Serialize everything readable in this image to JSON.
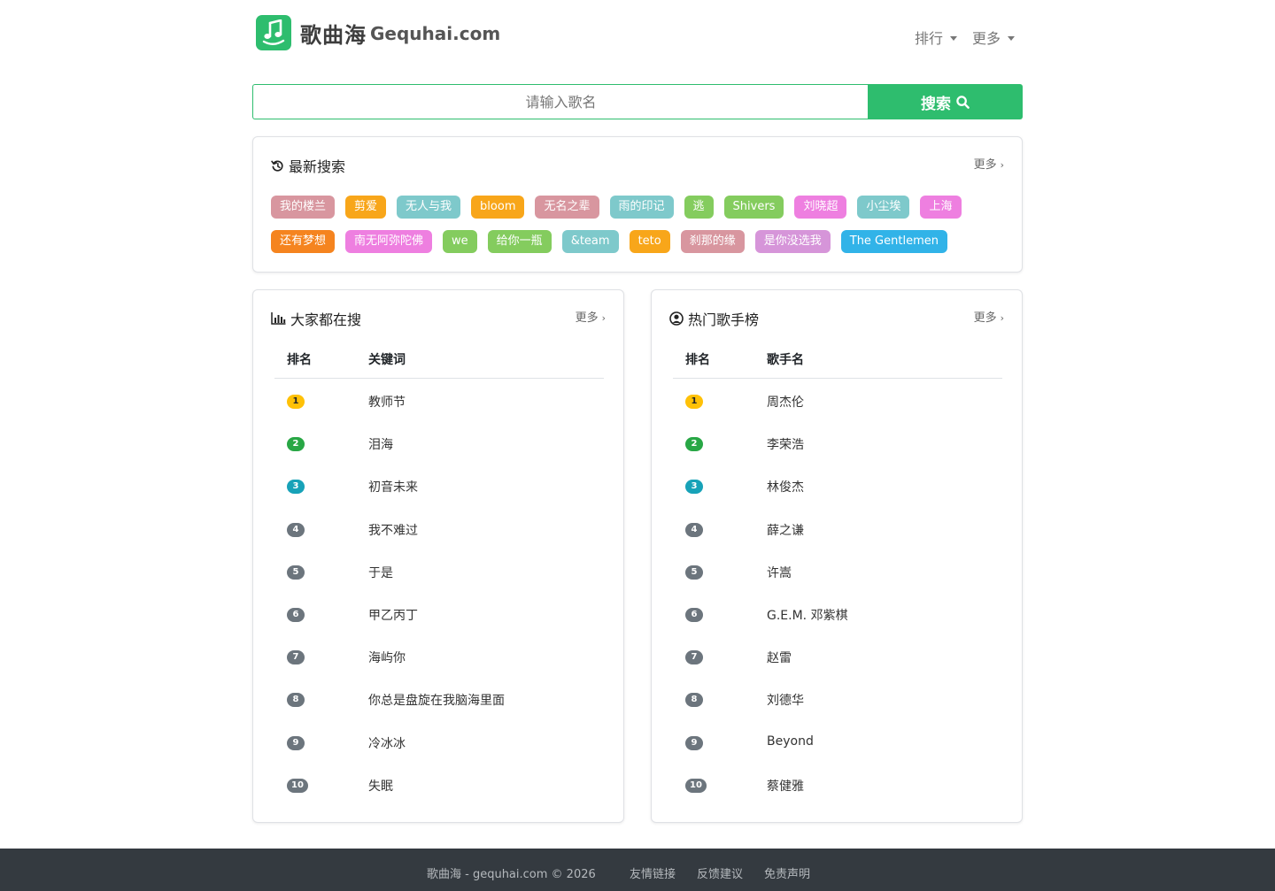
{
  "header": {
    "brand_cn": "歌曲海",
    "brand_en": "Gequhai.com",
    "nav": [
      {
        "label": "排行"
      },
      {
        "label": "更多"
      }
    ]
  },
  "search": {
    "placeholder": "请输入歌名",
    "value": "",
    "button_label": "搜索"
  },
  "recent": {
    "title": "最新搜索",
    "more": "更多",
    "tags": [
      {
        "label": "我的楼兰",
        "color": "#d8969f"
      },
      {
        "label": "剪爱",
        "color": "#f8a61a"
      },
      {
        "label": "无人与我",
        "color": "#7ec9cb"
      },
      {
        "label": "bloom",
        "color": "#f8a61a"
      },
      {
        "label": "无名之辈",
        "color": "#d8969f"
      },
      {
        "label": "雨的印记",
        "color": "#7ec9cb"
      },
      {
        "label": "逃",
        "color": "#84cc5e"
      },
      {
        "label": "Shivers",
        "color": "#84cc5e"
      },
      {
        "label": "刘晓超",
        "color": "#ee7fe0"
      },
      {
        "label": "小尘埃",
        "color": "#7ec9cb"
      },
      {
        "label": "上海",
        "color": "#ee7fe0"
      },
      {
        "label": "还有梦想",
        "color": "#f5841f"
      },
      {
        "label": "南无阿弥陀佛",
        "color": "#ee7fe0"
      },
      {
        "label": "we",
        "color": "#84cc5e"
      },
      {
        "label": "给你一瓶",
        "color": "#84cc5e"
      },
      {
        "label": "&team",
        "color": "#7ec9cb"
      },
      {
        "label": "teto",
        "color": "#f8a61a"
      },
      {
        "label": "刹那的缘",
        "color": "#d8969f"
      },
      {
        "label": "是你没选我",
        "color": "#d695d9"
      },
      {
        "label": "The Gentlemen",
        "color": "#31b3e8"
      }
    ]
  },
  "popular": {
    "title": "大家都在搜",
    "more": "更多",
    "col_rank": "排名",
    "col_name": "关键词",
    "rows": [
      {
        "rank": "1",
        "name": "教师节"
      },
      {
        "rank": "2",
        "name": "泪海"
      },
      {
        "rank": "3",
        "name": "初音未来"
      },
      {
        "rank": "4",
        "name": "我不难过"
      },
      {
        "rank": "5",
        "name": "于是"
      },
      {
        "rank": "6",
        "name": "甲乙丙丁"
      },
      {
        "rank": "7",
        "name": "海屿你"
      },
      {
        "rank": "8",
        "name": "你总是盘旋在我脑海里面"
      },
      {
        "rank": "9",
        "name": "冷冰冰"
      },
      {
        "rank": "10",
        "name": "失眠"
      }
    ]
  },
  "singers": {
    "title": "热门歌手榜",
    "more": "更多",
    "col_rank": "排名",
    "col_name": "歌手名",
    "rows": [
      {
        "rank": "1",
        "name": "周杰伦"
      },
      {
        "rank": "2",
        "name": "李荣浩"
      },
      {
        "rank": "3",
        "name": "林俊杰"
      },
      {
        "rank": "4",
        "name": "薛之谦"
      },
      {
        "rank": "5",
        "name": "许嵩"
      },
      {
        "rank": "6",
        "name": "G.E.M. 邓紫棋"
      },
      {
        "rank": "7",
        "name": "赵雷"
      },
      {
        "rank": "8",
        "name": "刘德华"
      },
      {
        "rank": "9",
        "name": "Beyond"
      },
      {
        "rank": "10",
        "name": "蔡健雅"
      }
    ]
  },
  "footer": {
    "copyright": "歌曲海 - gequhai.com © 2026",
    "links": [
      {
        "label": "友情链接"
      },
      {
        "label": "反馈建议"
      },
      {
        "label": "免责声明"
      }
    ]
  },
  "colors": {
    "accent": "#2ebd6e",
    "footer_bg": "#343a40"
  }
}
